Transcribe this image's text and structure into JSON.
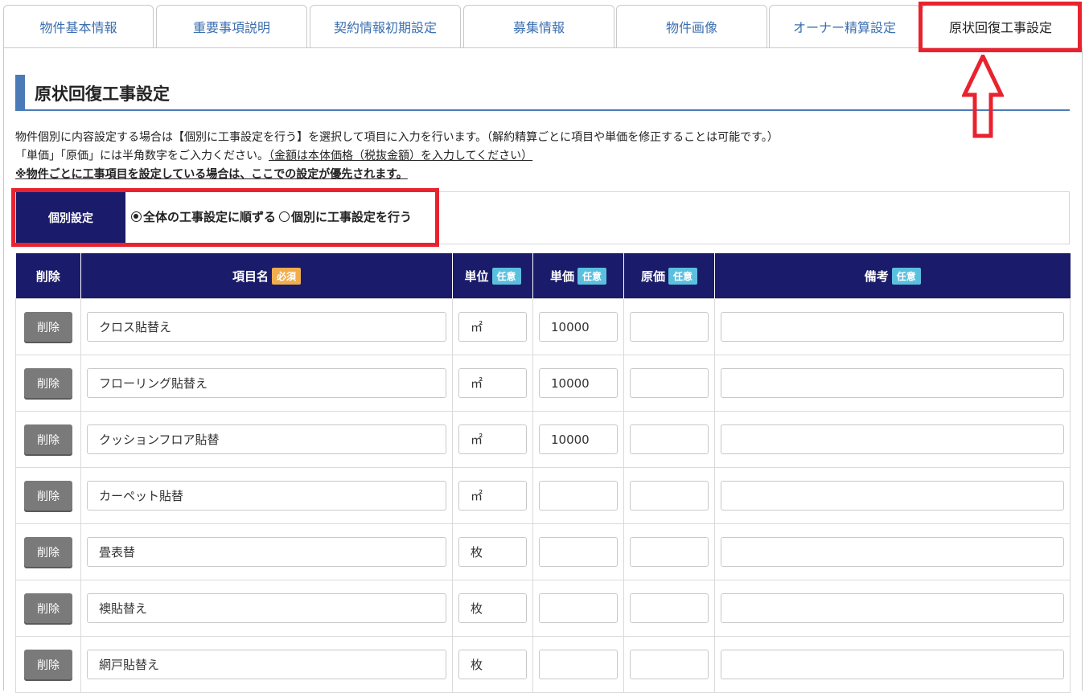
{
  "tabs": [
    {
      "label": "物件基本情報"
    },
    {
      "label": "重要事項説明"
    },
    {
      "label": "契約情報初期設定"
    },
    {
      "label": "募集情報"
    },
    {
      "label": "物件画像"
    },
    {
      "label": "オーナー精算設定"
    },
    {
      "label": "原状回復工事設定",
      "active": true
    }
  ],
  "section": {
    "title": "原状回復工事設定",
    "desc1": "物件個別に内容設定する場合は【個別に工事設定を行う】を選択して項目に入力を行います。（解約精算ごとに項目や単価を修正することは可能です。）",
    "desc2a": "「単価」「原価」には半角数字をご入力ください。",
    "desc2b": "（金額は本体価格（税抜金額）を入力してください）",
    "desc3": "※物件ごとに工事項目を設定している場合は、ここでの設定が優先されます。"
  },
  "individual": {
    "label": "個別設定",
    "option1": "全体の工事設定に順ずる",
    "option2": "個別に工事設定を行う",
    "selected": "option1"
  },
  "table": {
    "headers": {
      "delete": "削除",
      "item": "項目名",
      "unit": "単位",
      "price": "単価",
      "cost": "原価",
      "note": "備考"
    },
    "badge_required": "必須",
    "badge_optional": "任意",
    "delete_label": "削除",
    "rows": [
      {
        "item": "クロス貼替え",
        "unit": "㎡",
        "price": "10000",
        "cost": "",
        "note": ""
      },
      {
        "item": "フローリング貼替え",
        "unit": "㎡",
        "price": "10000",
        "cost": "",
        "note": ""
      },
      {
        "item": "クッションフロア貼替",
        "unit": "㎡",
        "price": "10000",
        "cost": "",
        "note": ""
      },
      {
        "item": "カーペット貼替",
        "unit": "㎡",
        "price": "",
        "cost": "",
        "note": ""
      },
      {
        "item": "畳表替",
        "unit": "枚",
        "price": "",
        "cost": "",
        "note": ""
      },
      {
        "item": "襖貼替え",
        "unit": "枚",
        "price": "",
        "cost": "",
        "note": ""
      },
      {
        "item": "網戸貼替え",
        "unit": "枚",
        "price": "",
        "cost": "",
        "note": ""
      }
    ]
  },
  "colors": {
    "header_navy": "#1b1b6b",
    "accent_blue": "#4a7bb7",
    "highlight_red": "#e8232f",
    "badge_required": "#f0ad4e",
    "badge_optional": "#5bc0de"
  }
}
